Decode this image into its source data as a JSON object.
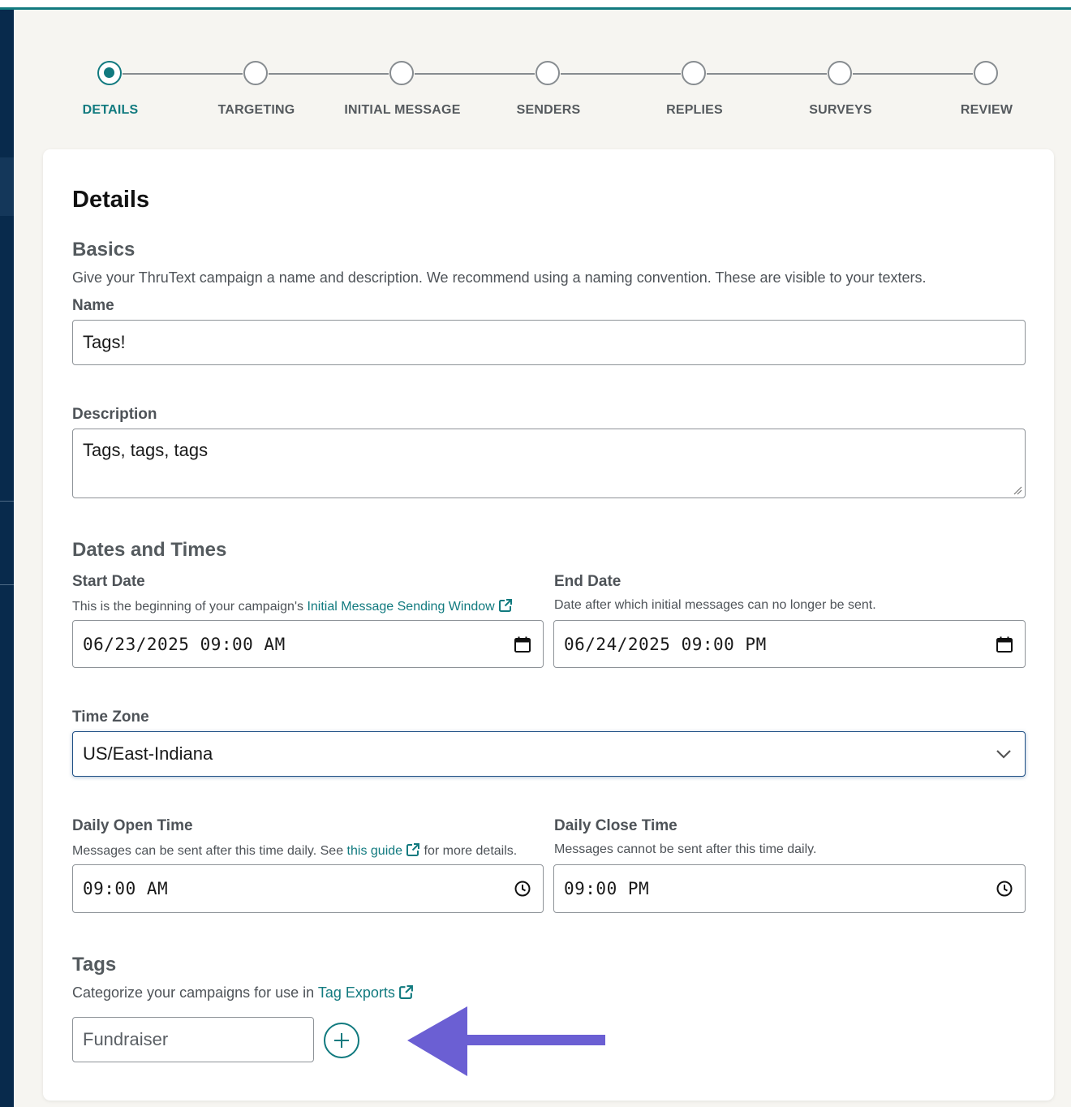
{
  "stepper": {
    "steps": [
      {
        "label": "DETAILS",
        "active": true
      },
      {
        "label": "TARGETING",
        "active": false
      },
      {
        "label": "INITIAL MESSAGE",
        "active": false
      },
      {
        "label": "SENDERS",
        "active": false
      },
      {
        "label": "REPLIES",
        "active": false
      },
      {
        "label": "SURVEYS",
        "active": false
      },
      {
        "label": "REVIEW",
        "active": false
      }
    ]
  },
  "details": {
    "title": "Details",
    "basics": {
      "heading": "Basics",
      "help": "Give your ThruText campaign a name and description. We recommend using a naming convention. These are visible to your texters.",
      "name_label": "Name",
      "name_value": "Tags!",
      "description_label": "Description",
      "description_value": "Tags, tags, tags"
    },
    "dates": {
      "heading": "Dates and Times",
      "start_label": "Start Date",
      "start_help_prefix": "This is the beginning of your campaign's",
      "start_help_link": "Initial Message Sending Window",
      "start_value": "06/23/2025 09:00 AM",
      "end_label": "End Date",
      "end_help": "Date after which initial messages can no longer be sent.",
      "end_value": "06/24/2025 09:00 PM",
      "timezone_label": "Time Zone",
      "timezone_value": "US/East-Indiana",
      "open_label": "Daily Open Time",
      "open_help_prefix": "Messages can be sent after this time daily. See",
      "open_help_link": "this guide",
      "open_help_suffix": "for more details.",
      "open_value": "09:00 AM",
      "close_label": "Daily Close Time",
      "close_help": "Messages cannot be sent after this time daily.",
      "close_value": "09:00 PM"
    },
    "tags": {
      "heading": "Tags",
      "help_prefix": "Categorize your campaigns for use in",
      "help_link": "Tag Exports",
      "input_placeholder": "Fundraiser"
    }
  },
  "colors": {
    "accent": "#117a7f",
    "nav": "#082a4c",
    "annotation_arrow": "#6b5fd3"
  }
}
